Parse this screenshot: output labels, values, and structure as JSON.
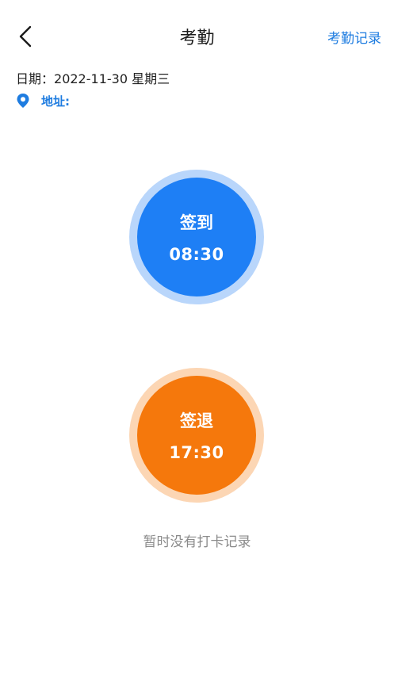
{
  "header": {
    "title": "考勤",
    "record_link": "考勤记录"
  },
  "info": {
    "date_label": "日期：",
    "date_value": "2022-11-30",
    "weekday": "星期三",
    "address_label": "地址:",
    "address_value": ""
  },
  "check_in": {
    "label": "签到",
    "time": "08:30",
    "color": "#1e7ff5",
    "ring_color": "#b9d6fb"
  },
  "check_out": {
    "label": "签退",
    "time": "17:30",
    "color": "#f5780c",
    "ring_color": "#fcd6b4"
  },
  "status": {
    "empty_text": "暂时没有打卡记录"
  },
  "colors": {
    "accent": "#1e7ce0"
  },
  "icons": {
    "back": "chevron-left-icon",
    "location": "location-pin-icon"
  }
}
